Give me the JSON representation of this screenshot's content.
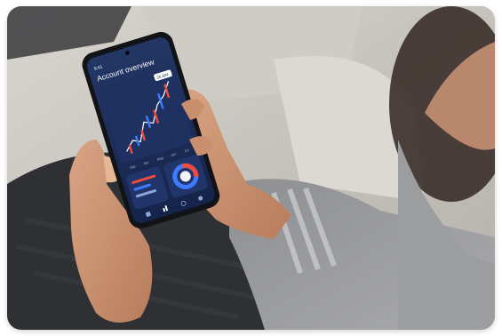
{
  "phone": {
    "status_time": "9:41",
    "screen_title": "Account overview",
    "price_tag": "26,304",
    "months": [
      "Mar",
      "Apr",
      "May",
      "Jun",
      "Jul"
    ]
  },
  "colors": {
    "screen_bg": "#1b2a52",
    "accent_red": "#ef4b3f",
    "accent_blue": "#3d7bff",
    "sleeve_gray": "#9a9b9d"
  }
}
